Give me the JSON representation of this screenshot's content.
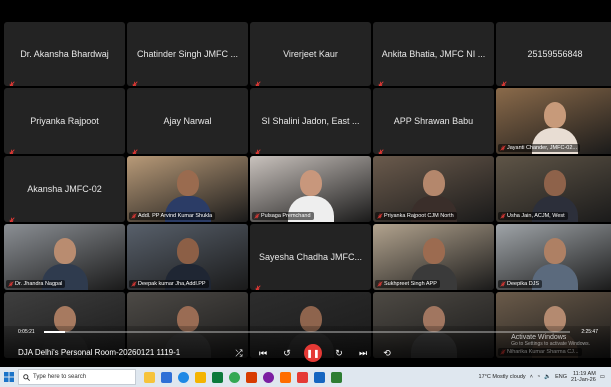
{
  "participants": [
    {
      "name": "Dr. Akansha Bhardwaj",
      "video": false
    },
    {
      "name": "Chatinder Singh JMFC ...",
      "video": false
    },
    {
      "name": "Virerjeet Kaur",
      "video": false
    },
    {
      "name": "Ankita Bhatia, JMFC NI ...",
      "video": false
    },
    {
      "name": "25159556848",
      "video": false
    },
    {
      "name": "Priyanka Rajpoot",
      "video": false
    },
    {
      "name": "Ajay Narwal",
      "video": false
    },
    {
      "name": "SI Shalini Jadon, East ...",
      "video": false
    },
    {
      "name": "APP Shrawan Babu",
      "video": false
    },
    {
      "name": "Jayanti Chander, JMFC-02...",
      "video": true,
      "bg": "#8a6a4a",
      "skin": "#c79a7a",
      "shirt": "#e8ddd3"
    },
    {
      "name": "Akansha JMFC-02",
      "video": false
    },
    {
      "name": "Addl. PP Arvind Kumar Shukla",
      "video": true,
      "bg": "#b89a78",
      "skin": "#9a6b4f",
      "shirt": "#2b3c66"
    },
    {
      "name": "Pulsaga Premchand",
      "video": true,
      "bg": "#c9c2bd",
      "skin": "#c8977c",
      "shirt": "#eeeeee"
    },
    {
      "name": "Priyanka Rajpoot CJM North",
      "video": true,
      "bg": "#6a5a4c",
      "skin": "#b4876c",
      "shirt": "#3a2e2a"
    },
    {
      "name": "Usha Jain, ACJM, West",
      "video": true,
      "bg": "#5f5547",
      "skin": "#8e624a",
      "shirt": "#2c2f3a"
    },
    {
      "name": "Dr. Jhandra Nagpal",
      "video": true,
      "bg": "#8b8f94",
      "skin": "#b98c70",
      "shirt": "#2f3b4e"
    },
    {
      "name": "Deepak kumar Jha,Addl.PP",
      "video": true,
      "bg": "#58606b",
      "skin": "#8c5f46",
      "shirt": "#1f2633"
    },
    {
      "name": "Sayesha Chadha JMFC...",
      "video": false
    },
    {
      "name": "Sukhpreet Singh APP",
      "video": true,
      "bg": "#b2a38e",
      "skin": "#9c6b50",
      "shirt": "#3a3a3a"
    },
    {
      "name": "Deepika DJS",
      "video": true,
      "bg": "#9fa4a8",
      "skin": "#ae8064",
      "shirt": "#5b6a7d"
    },
    {
      "name": "",
      "video": true,
      "bg": "#3f3f3f",
      "skin": "#a77a60",
      "shirt": "#2a2a2a"
    },
    {
      "name": "",
      "video": true,
      "bg": "#4d4a46",
      "skin": "#9a6c54",
      "shirt": "#333"
    },
    {
      "name": "",
      "video": true,
      "bg": "#2d2d2d",
      "skin": "#8e644d",
      "shirt": "#2a2a2a"
    },
    {
      "name": "",
      "video": true,
      "bg": "#4e4a44",
      "skin": "#a17660",
      "shirt": "#3a3a3a"
    },
    {
      "name": "Niharika Kumar Sharma CJ...",
      "video": true,
      "bg": "#6b5b4a",
      "skin": "#b48a70",
      "shirt": "#4a3c32"
    }
  ],
  "player": {
    "time_left": "0:05:21",
    "time_right": "2:25:47",
    "progress": 0.04,
    "title": "DJA Delhi's Personal Room-20260121 1119-1",
    "activate_title": "Activate Windows",
    "activate_sub": "Go to Settings to activate Windows."
  },
  "taskbar": {
    "search_placeholder": "Type here to search",
    "weather": "17°C Mostly cloudy",
    "lang": "ENG",
    "time": "11:19 AM",
    "date": "21-Jan-26"
  }
}
